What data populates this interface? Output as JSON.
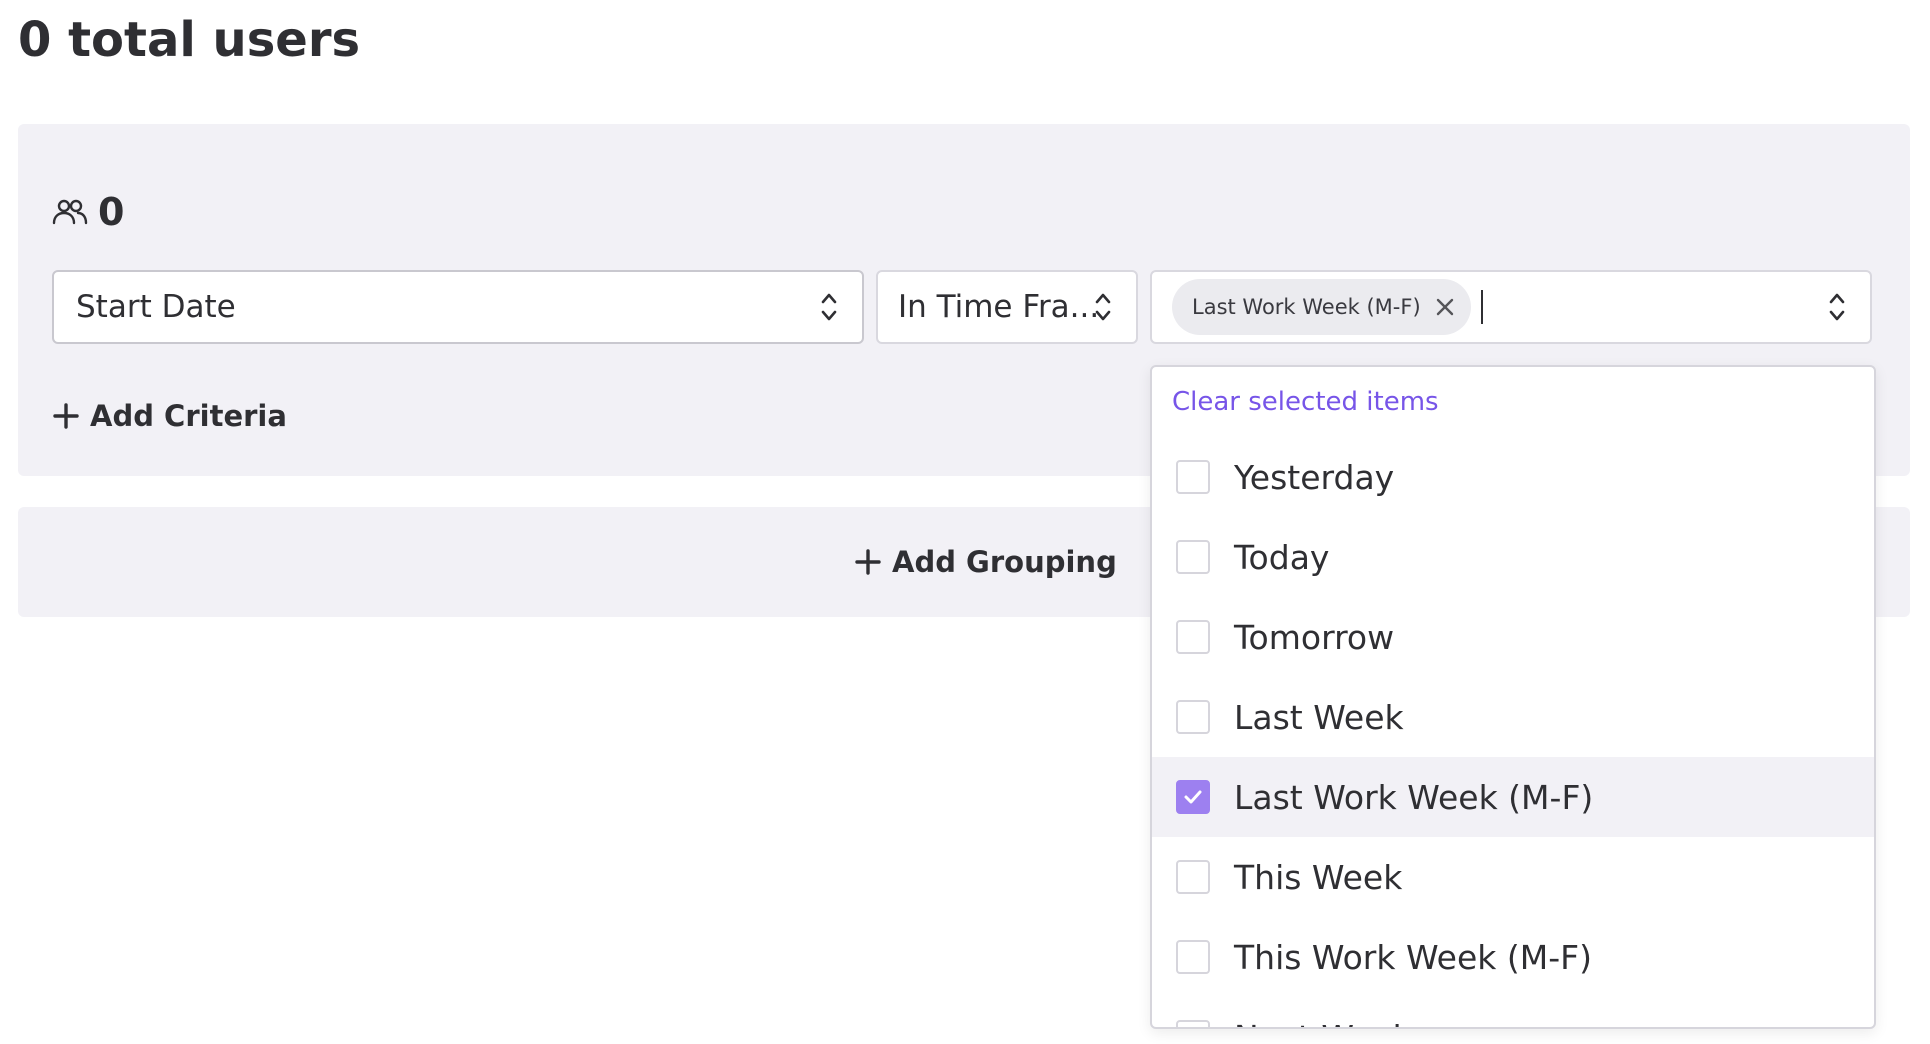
{
  "page": {
    "title": "0 total users"
  },
  "criteria": {
    "user_count": "0",
    "field_select": {
      "value": "Start Date"
    },
    "operator_select": {
      "value": "In Time Fra..."
    },
    "value_select": {
      "tags": [
        "Last Work Week (M-F)"
      ]
    },
    "add_criteria_label": "Add Criteria"
  },
  "grouping": {
    "add_grouping_label": "Add Grouping"
  },
  "dropdown": {
    "clear_label": "Clear selected items",
    "options": [
      {
        "label": "Yesterday",
        "checked": false
      },
      {
        "label": "Today",
        "checked": false
      },
      {
        "label": "Tomorrow",
        "checked": false
      },
      {
        "label": "Last Week",
        "checked": false
      },
      {
        "label": "Last Work Week (M-F)",
        "checked": true
      },
      {
        "label": "This Week",
        "checked": false
      },
      {
        "label": "This Work Week (M-F)",
        "checked": false
      },
      {
        "label": "Next Week",
        "checked": false
      }
    ]
  },
  "colors": {
    "accent": "#7755e8",
    "checkbox_checked": "#9d80f0",
    "panel_bg": "#f2f1f6",
    "text": "#2f2f33"
  },
  "icons": {
    "user_count": "users-icon",
    "chevron": "chevron-up-down-icon",
    "tag_remove": "close-icon",
    "add": "plus-icon",
    "check": "checkmark-icon"
  }
}
